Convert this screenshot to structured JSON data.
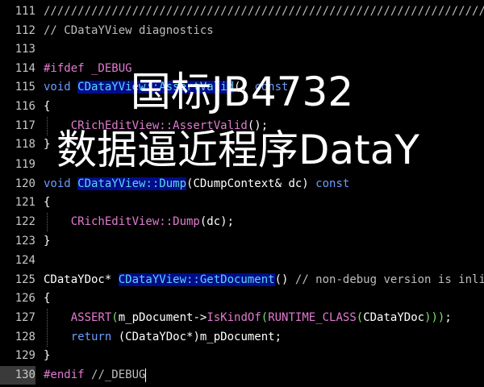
{
  "editor": {
    "lines": [
      {
        "num": "111",
        "code": "////////////////////////////////////////////////////////////////////"
      },
      {
        "num": "112",
        "code": "// CDataYView diagnostics"
      },
      {
        "num": "113",
        "code": ""
      },
      {
        "num": "114",
        "code": "#ifdef _DEBUG"
      },
      {
        "num": "115",
        "code": "void CDataYView::AssertValid() const"
      },
      {
        "num": "116",
        "code": "{"
      },
      {
        "num": "117",
        "code": "    CRichEditView::AssertValid();"
      },
      {
        "num": "118",
        "code": "}"
      },
      {
        "num": "119",
        "code": ""
      },
      {
        "num": "120",
        "code": "void CDataYView::Dump(CDumpContext& dc) const"
      },
      {
        "num": "121",
        "code": "{"
      },
      {
        "num": "122",
        "code": "    CRichEditView::Dump(dc);"
      },
      {
        "num": "123",
        "code": "}"
      },
      {
        "num": "124",
        "code": ""
      },
      {
        "num": "125",
        "code": "CDataYDoc* CDataYView::GetDocument() // non-debug version is inline"
      },
      {
        "num": "126",
        "code": "{"
      },
      {
        "num": "127",
        "code": "    ASSERT(m_pDocument->IsKindOf(RUNTIME_CLASS(CDataYDoc)));"
      },
      {
        "num": "128",
        "code": "    return (CDataYDoc*)m_pDocument;"
      },
      {
        "num": "129",
        "code": "}"
      },
      {
        "num": "130",
        "code": "#endif //_DEBUG"
      }
    ],
    "current_line": "130"
  },
  "overlay": {
    "line1": "国标JB4732",
    "line2": "数据逼近程序DataY"
  },
  "colors": {
    "background": "#000000",
    "comment": "#bdbdbd",
    "preprocessor": "#e07bd0",
    "keyword": "#6f9cff",
    "function_highlight_bg": "#000c8c",
    "function": "#5dd5e8"
  }
}
